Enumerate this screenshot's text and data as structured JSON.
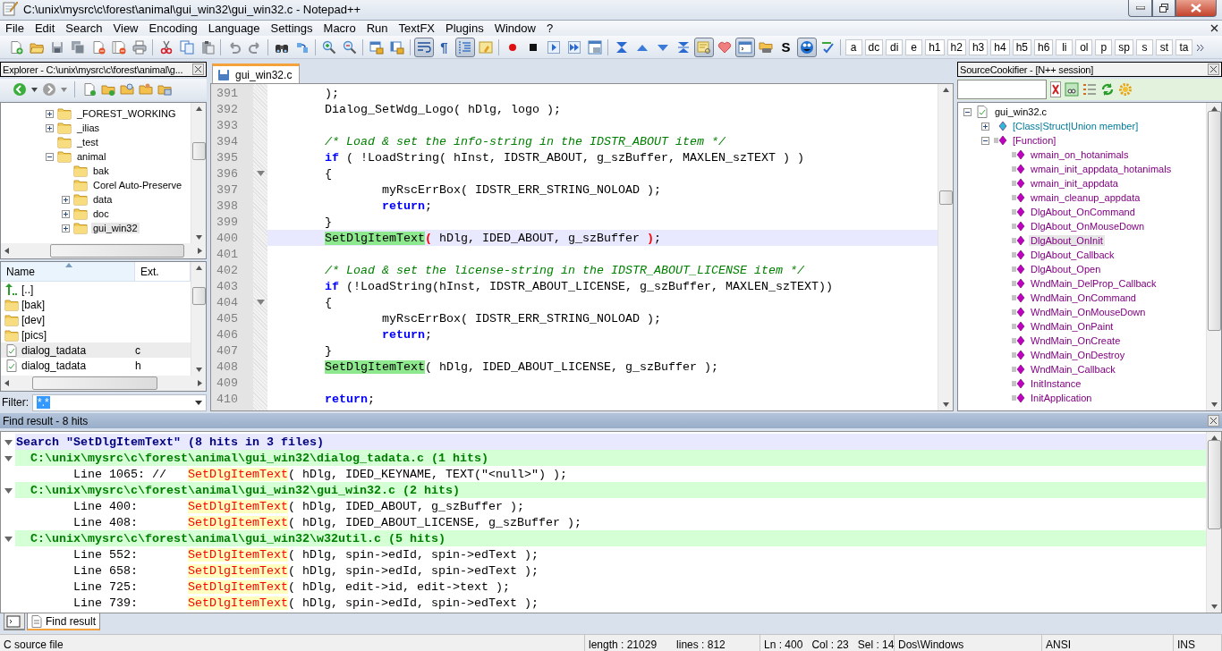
{
  "window": {
    "title": "C:\\unix\\mysrc\\c\\forest\\animal\\gui_win32\\gui_win32.c - Notepad++"
  },
  "menu": [
    "File",
    "Edit",
    "Search",
    "View",
    "Encoding",
    "Language",
    "Settings",
    "Macro",
    "Run",
    "TextFX",
    "Plugins",
    "Window",
    "?"
  ],
  "toolbar": {
    "groups": [
      {
        "buttons": [
          {
            "kind": "new",
            "pressed": false
          },
          {
            "kind": "open",
            "pressed": false
          },
          {
            "kind": "save",
            "pressed": false
          },
          {
            "kind": "save-all",
            "pressed": false
          },
          {
            "kind": "close",
            "pressed": false
          },
          {
            "kind": "close-all",
            "pressed": false
          },
          {
            "kind": "print",
            "pressed": false
          }
        ]
      },
      {
        "buttons": [
          {
            "kind": "cut",
            "pressed": false
          },
          {
            "kind": "copy",
            "pressed": false
          },
          {
            "kind": "paste",
            "pressed": false
          }
        ]
      },
      {
        "buttons": [
          {
            "kind": "undo",
            "pressed": false
          },
          {
            "kind": "redo",
            "pressed": false
          }
        ]
      },
      {
        "buttons": [
          {
            "kind": "find",
            "pressed": false
          },
          {
            "kind": "replace",
            "pressed": false
          }
        ]
      },
      {
        "buttons": [
          {
            "kind": "zoom-in",
            "pressed": false
          },
          {
            "kind": "zoom-out",
            "pressed": false
          }
        ]
      },
      {
        "buttons": [
          {
            "kind": "sync-v",
            "pressed": false
          },
          {
            "kind": "sync-h",
            "pressed": false
          }
        ]
      },
      {
        "buttons": [
          {
            "kind": "wrap",
            "pressed": true
          },
          {
            "kind": "pilcrow",
            "label": "¶",
            "pressed": false
          },
          {
            "kind": "indent-guide",
            "pressed": true
          },
          {
            "kind": "note",
            "pressed": false
          }
        ]
      },
      {
        "buttons": [
          {
            "kind": "record",
            "pressed": false
          },
          {
            "kind": "stop",
            "pressed": false
          },
          {
            "kind": "play",
            "pressed": false
          },
          {
            "kind": "play-multi",
            "pressed": false
          },
          {
            "kind": "save-macro",
            "pressed": false
          }
        ]
      },
      {
        "buttons": [
          {
            "kind": "fold-all",
            "pressed": false
          },
          {
            "kind": "up",
            "pressed": false
          },
          {
            "kind": "down",
            "pressed": false
          },
          {
            "kind": "unfold-all",
            "pressed": false
          },
          {
            "kind": "doc-map",
            "pressed": true
          },
          {
            "kind": "heart",
            "pressed": false
          },
          {
            "kind": "console",
            "pressed": true
          },
          {
            "kind": "folder-print",
            "pressed": false
          },
          {
            "kind": "text",
            "label": "S",
            "pressed": false
          },
          {
            "kind": "creature",
            "pressed": true
          },
          {
            "kind": "spell",
            "pressed": false
          }
        ]
      }
    ],
    "tags": [
      "a",
      "dc",
      "di",
      "e",
      "h1",
      "h2",
      "h3",
      "h4",
      "h5",
      "h6",
      "li",
      "ol",
      "p",
      "sp",
      "s",
      "st",
      "ta"
    ]
  },
  "explorer": {
    "title": "Explorer - C:\\unix\\mysrc\\c\\forest\\animal\\g...",
    "tree": [
      {
        "label": "_FOREST_WORKING",
        "expanded": false,
        "selected": false
      },
      {
        "label": "_ilias",
        "expanded": false,
        "selected": false
      },
      {
        "label": "_test",
        "selected": false
      },
      {
        "label": "animal",
        "expanded": true,
        "selected": false,
        "children": [
          {
            "label": "bak",
            "selected": false
          },
          {
            "label": "Corel Auto-Preserve",
            "selected": false
          },
          {
            "label": "data",
            "expanded": false,
            "selected": false
          },
          {
            "label": "doc",
            "expanded": false,
            "selected": false
          },
          {
            "label": "gui_win32",
            "expanded": false,
            "selected": true
          }
        ]
      }
    ],
    "columns": [
      "Name",
      "Ext."
    ],
    "files": [
      {
        "kind": "up",
        "name": "[..]",
        "selected": false
      },
      {
        "kind": "folder",
        "name": "[bak]",
        "selected": false
      },
      {
        "kind": "folder",
        "name": "[dev]",
        "selected": false
      },
      {
        "kind": "folder",
        "name": "[pics]",
        "selected": false
      },
      {
        "kind": "file",
        "name": "dialog_tadata",
        "ext": "c",
        "selected": true
      },
      {
        "kind": "file",
        "name": "dialog_tadata",
        "ext": "h",
        "selected": false
      }
    ],
    "filter": {
      "label": "Filter:",
      "value": "*.*"
    }
  },
  "editor": {
    "tabs": [
      {
        "label": "gui_win32.c",
        "selected": true
      }
    ],
    "lines": [
      {
        "number": "391",
        "fold": false,
        "current": false,
        "segments": [
          {
            "kind": "plain",
            "text": ");"
          }
        ]
      },
      {
        "number": "392",
        "fold": false,
        "current": false,
        "segments": [
          {
            "kind": "plain",
            "text": "Dialog_SetWdg_Logo( hDlg, logo );"
          }
        ]
      },
      {
        "number": "393",
        "fold": false,
        "current": false
      },
      {
        "number": "394",
        "fold": false,
        "current": false,
        "segments": [
          {
            "kind": "comment",
            "text": "/* Load & set the info-string in the IDSTR_ABOUT item */"
          }
        ]
      },
      {
        "number": "395",
        "fold": false,
        "current": false,
        "segments": [
          {
            "kind": "keyword",
            "text": "if"
          },
          {
            "kind": "plain",
            "text": " ( !LoadString( hInst, IDSTR_ABOUT, g_szBuffer, MAXLEN_szTEXT ) )"
          }
        ]
      },
      {
        "number": "396",
        "fold": true,
        "current": false,
        "segments": [
          {
            "kind": "plain",
            "text": "{"
          }
        ]
      },
      {
        "number": "397",
        "fold": false,
        "current": false,
        "segments": [
          {
            "kind": "plain",
            "text": "        myRscErrBox( IDSTR_ERR_STRING_NOLOAD );"
          }
        ]
      },
      {
        "number": "398",
        "fold": false,
        "current": false,
        "segments": [
          {
            "kind": "keyword",
            "text": "        return"
          },
          {
            "kind": "plain",
            "text": ";"
          }
        ]
      },
      {
        "number": "399",
        "fold": false,
        "current": false,
        "segments": [
          {
            "kind": "plain",
            "text": "}"
          }
        ]
      },
      {
        "number": "400",
        "fold": false,
        "current": true,
        "segments": [
          {
            "kind": "mark",
            "text": "SetDlgItemText"
          },
          {
            "kind": "brace",
            "text": "("
          },
          {
            "kind": "plain",
            "text": " hDlg, IDED_ABOUT, g_szBuffer "
          },
          {
            "kind": "brace",
            "text": ")"
          },
          {
            "kind": "plain",
            "text": ";"
          }
        ]
      },
      {
        "number": "401",
        "fold": false,
        "current": false
      },
      {
        "number": "402",
        "fold": false,
        "current": false,
        "segments": [
          {
            "kind": "comment",
            "text": "/* Load & set the license-string in the IDSTR_ABOUT_LICENSE item */"
          }
        ]
      },
      {
        "number": "403",
        "fold": false,
        "current": false,
        "segments": [
          {
            "kind": "keyword",
            "text": "if"
          },
          {
            "kind": "plain",
            "text": " (!LoadString(hInst, IDSTR_ABOUT_LICENSE, g_szBuffer, MAXLEN_szTEXT))"
          }
        ]
      },
      {
        "number": "404",
        "fold": true,
        "current": false,
        "segments": [
          {
            "kind": "plain",
            "text": "{"
          }
        ]
      },
      {
        "number": "405",
        "fold": false,
        "current": false,
        "segments": [
          {
            "kind": "plain",
            "text": "        myRscErrBox( IDSTR_ERR_STRING_NOLOAD );"
          }
        ]
      },
      {
        "number": "406",
        "fold": false,
        "current": false,
        "segments": [
          {
            "kind": "keyword",
            "text": "        return"
          },
          {
            "kind": "plain",
            "text": ";"
          }
        ]
      },
      {
        "number": "407",
        "fold": false,
        "current": false,
        "segments": [
          {
            "kind": "plain",
            "text": "}"
          }
        ]
      },
      {
        "number": "408",
        "fold": false,
        "current": false,
        "segments": [
          {
            "kind": "mark",
            "text": "SetDlgItemText"
          },
          {
            "kind": "plain",
            "text": "( hDlg, IDED_ABOUT_LICENSE, g_szBuffer );"
          }
        ]
      },
      {
        "number": "409",
        "fold": false,
        "current": false
      },
      {
        "number": "410",
        "fold": false,
        "current": false,
        "segments": [
          {
            "kind": "keyword",
            "text": "return"
          },
          {
            "kind": "plain",
            "text": ";"
          }
        ]
      }
    ]
  },
  "cookifier": {
    "title": "SourceCookifier - [N++ session]",
    "tree": [
      {
        "kind": "file",
        "label": "gui_win32.c",
        "expanded": true,
        "selected": false,
        "children": [
          {
            "kind": "member-group",
            "label": "[Class|Struct|Union member]",
            "expanded": false,
            "selected": false
          },
          {
            "kind": "function-group",
            "label": "[Function]",
            "expanded": true,
            "selected": false,
            "children": [
              {
                "kind": "function",
                "label": "wmain_on_hotanimals",
                "selected": false
              },
              {
                "kind": "function",
                "label": "wmain_init_appdata_hotanimals",
                "selected": false
              },
              {
                "kind": "function",
                "label": "wmain_init_appdata",
                "selected": false
              },
              {
                "kind": "function",
                "label": "wmain_cleanup_appdata",
                "selected": false
              },
              {
                "kind": "function",
                "label": "DlgAbout_OnCommand",
                "selected": false
              },
              {
                "kind": "function",
                "label": "DlgAbout_OnMouseDown",
                "selected": false
              },
              {
                "kind": "function",
                "label": "DlgAbout_OnInit",
                "selected": true
              },
              {
                "kind": "function",
                "label": "DlgAbout_Callback",
                "selected": false
              },
              {
                "kind": "function",
                "label": "DlgAbout_Open",
                "selected": false
              },
              {
                "kind": "function",
                "label": "WndMain_DelProp_Callback",
                "selected": false
              },
              {
                "kind": "function",
                "label": "WndMain_OnCommand",
                "selected": false
              },
              {
                "kind": "function",
                "label": "WndMain_OnMouseDown",
                "selected": false
              },
              {
                "kind": "function",
                "label": "WndMain_OnPaint",
                "selected": false
              },
              {
                "kind": "function",
                "label": "WndMain_OnCreate",
                "selected": false
              },
              {
                "kind": "function",
                "label": "WndMain_OnDestroy",
                "selected": false
              },
              {
                "kind": "function",
                "label": "WndMain_Callback",
                "selected": false
              },
              {
                "kind": "function",
                "label": "InitInstance",
                "selected": false
              },
              {
                "kind": "function",
                "label": "InitApplication",
                "selected": false
              }
            ]
          }
        ]
      }
    ]
  },
  "find": {
    "title": "Find result - 8 hits",
    "search": {
      "text": "Search \"SetDlgItemText\" (8 hits in 3 files)",
      "expanded": true,
      "files": [
        {
          "path": "C:\\unix\\mysrc\\c\\forest\\animal\\gui_win32\\dialog_tadata.c (1 hits)",
          "expanded": true,
          "hits": [
            {
              "prefix": "Line 1065: //",
              "match": "SetDlgItemText",
              "rest": "( hDlg, IDED_KEYNAME, TEXT(\"<null>\") );"
            }
          ]
        },
        {
          "path": "C:\\unix\\mysrc\\c\\forest\\animal\\gui_win32\\gui_win32.c (2 hits)",
          "expanded": true,
          "hits": [
            {
              "prefix": "Line 400:",
              "match": "SetDlgItemText",
              "rest": "( hDlg, IDED_ABOUT, g_szBuffer );"
            },
            {
              "prefix": "Line 408:",
              "match": "SetDlgItemText",
              "rest": "( hDlg, IDED_ABOUT_LICENSE, g_szBuffer );"
            }
          ]
        },
        {
          "path": "C:\\unix\\mysrc\\c\\forest\\animal\\gui_win32\\w32util.c (5 hits)",
          "expanded": true,
          "hits": [
            {
              "prefix": "Line 552:",
              "match": "SetDlgItemText",
              "rest": "( hDlg, spin->edId, spin->edText );"
            },
            {
              "prefix": "Line 658:",
              "match": "SetDlgItemText",
              "rest": "( hDlg, spin->edId, spin->edText );"
            },
            {
              "prefix": "Line 725:",
              "match": "SetDlgItemText",
              "rest": "( hDlg, edit->id, edit->text );"
            },
            {
              "prefix": "Line 739:",
              "match": "SetDlgItemText",
              "rest": "( hDlg, spin->edId, spin->edText );"
            }
          ]
        }
      ]
    }
  },
  "bottom_tabs": [
    {
      "kind": "console",
      "selected": false
    },
    {
      "kind": "find",
      "label": "Find result",
      "selected": true
    }
  ],
  "status_bar": {
    "file_type": "C source file",
    "length": "length : 21029",
    "lines": "lines : 812",
    "line": "Ln : 400",
    "column": "Col : 23",
    "selection": "Sel : 14",
    "eol": "Dos\\Windows",
    "encoding": "ANSI",
    "mode": "INS"
  }
}
